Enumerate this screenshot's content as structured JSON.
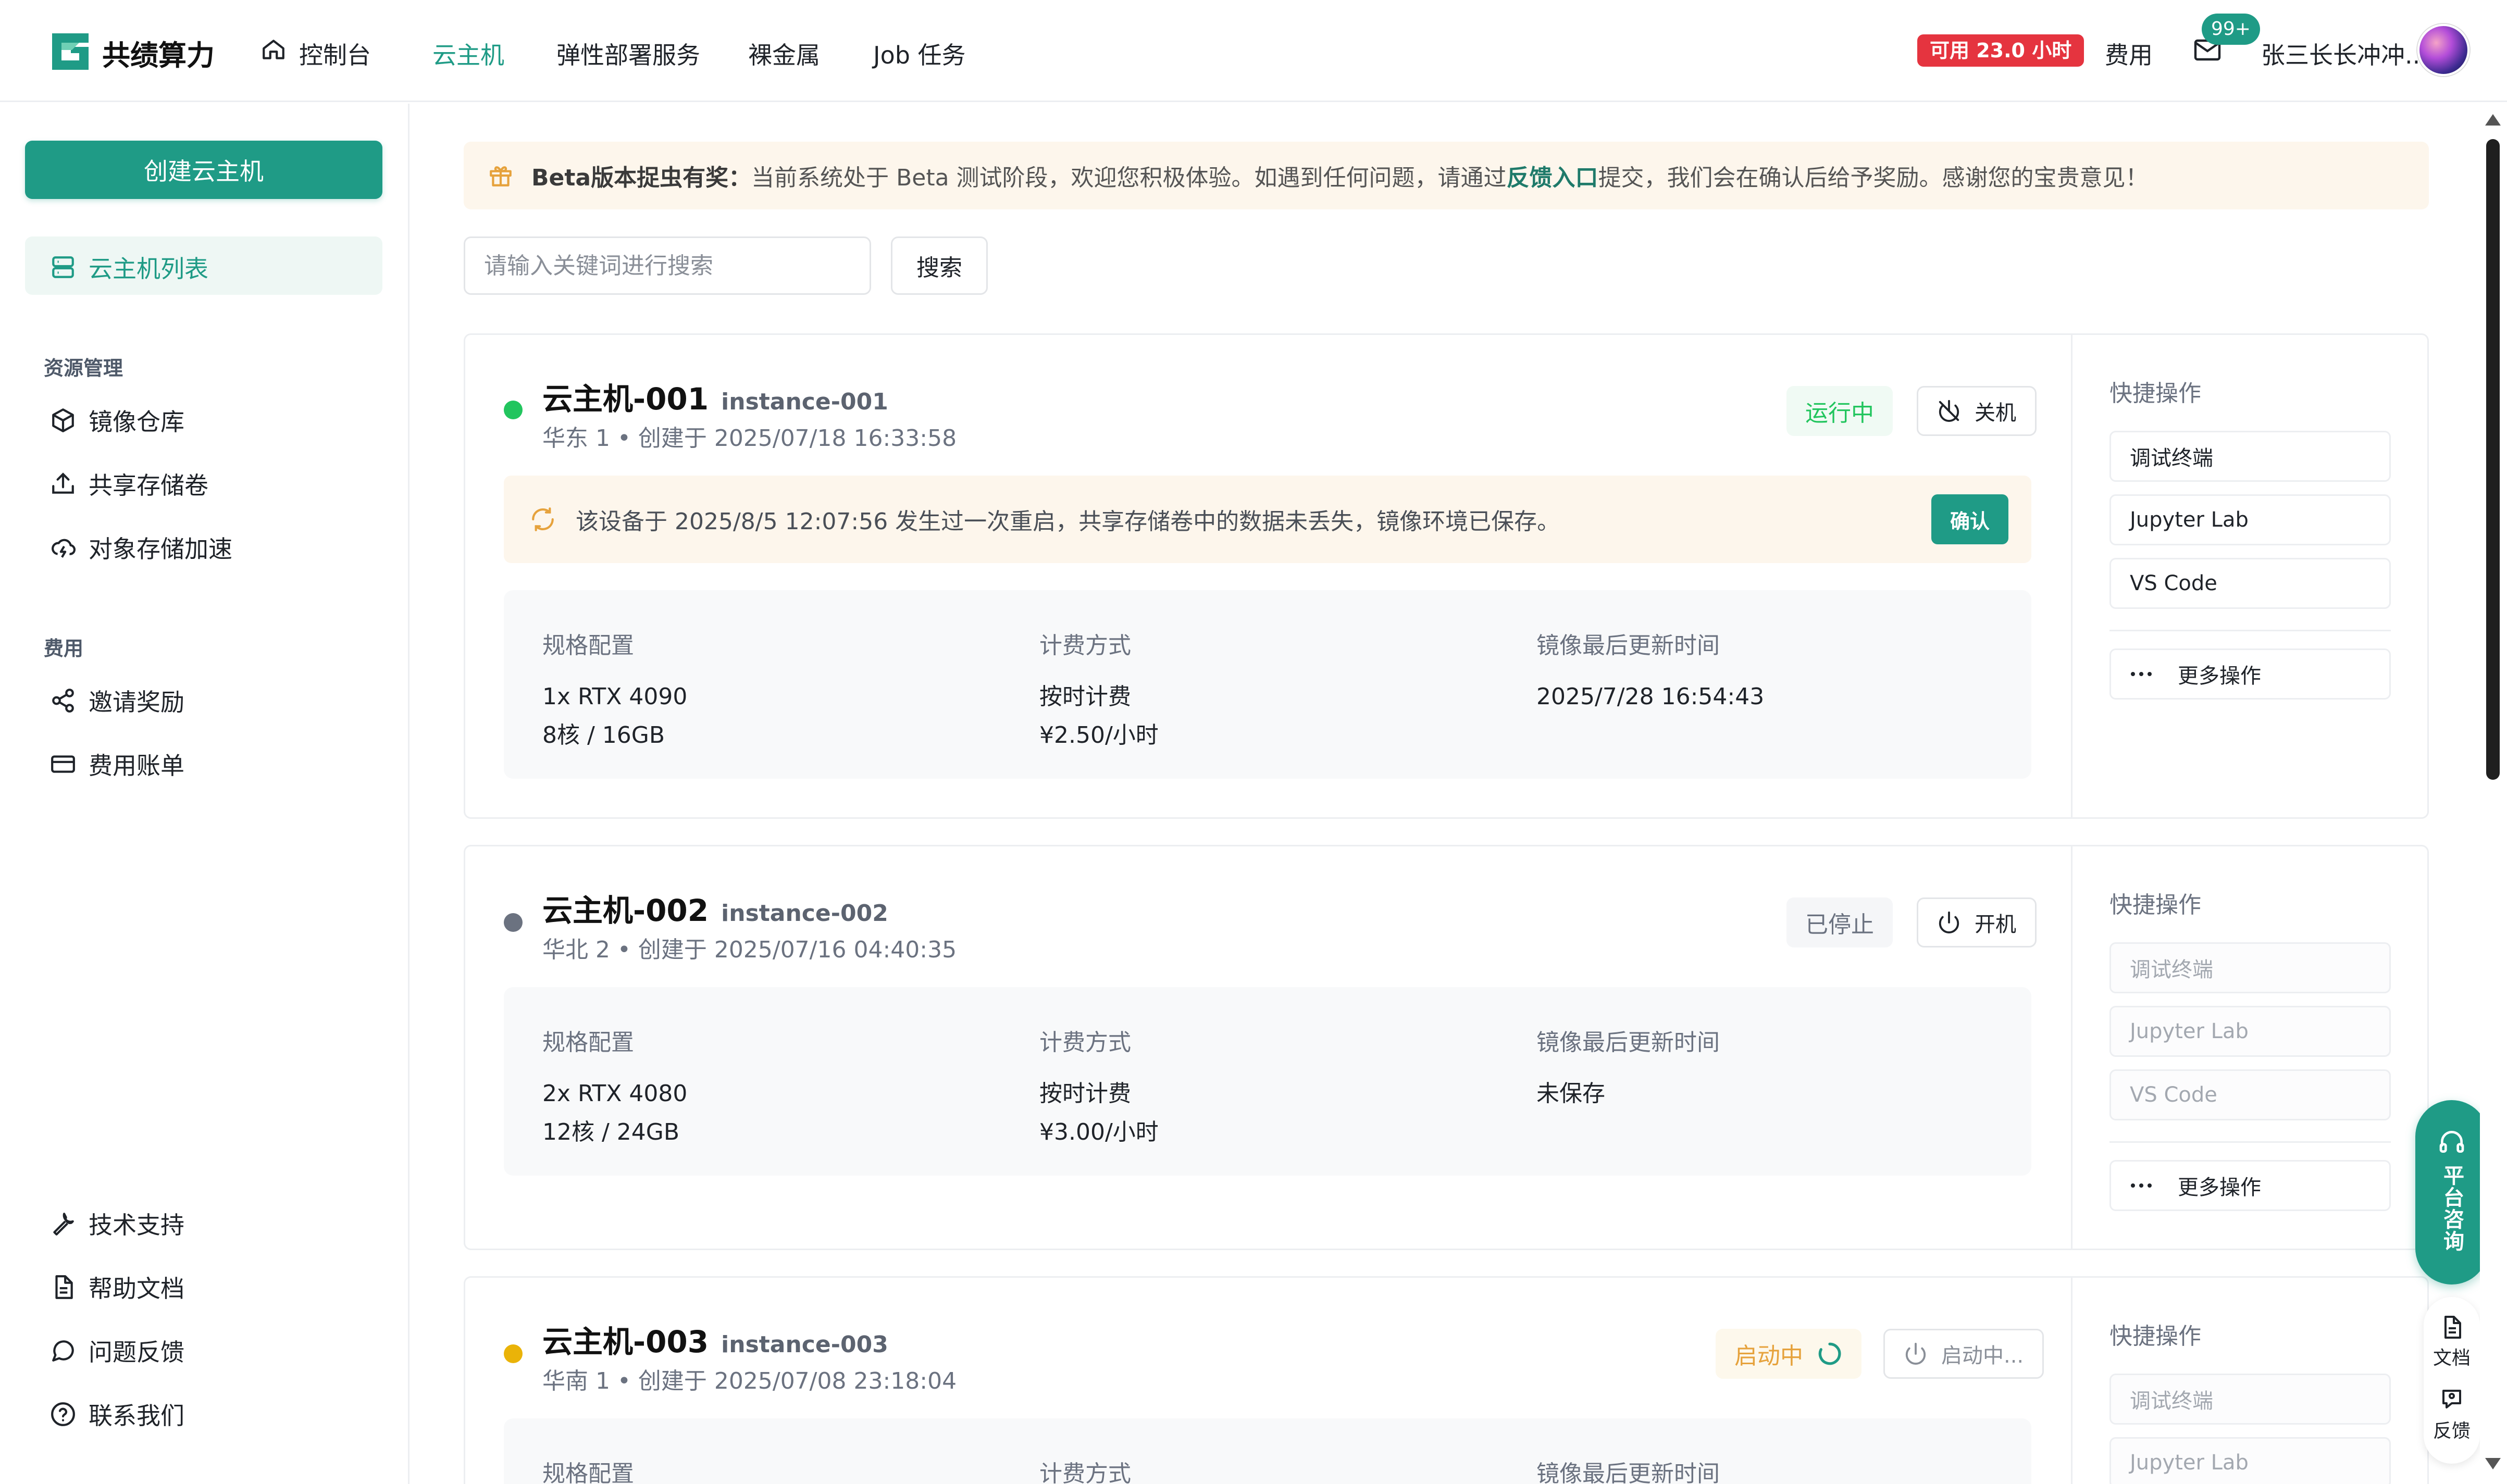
{
  "header": {
    "brand": "共绩算力",
    "nav": [
      {
        "label": "控制台"
      },
      {
        "label": "云主机"
      },
      {
        "label": "弹性部署服务"
      },
      {
        "label": "裸金属"
      },
      {
        "label": "Job 任务"
      }
    ],
    "credit_badge": "可用 23.0 小时",
    "fee_label": "费用",
    "mail_count": "99+",
    "username": "张三长长冲冲..",
    "accent_color": "#1f9b86"
  },
  "sidebar": {
    "create_button": "创建云主机",
    "active_item": "云主机列表",
    "section_resources": "资源管理",
    "resources": [
      "镜像仓库",
      "共享存储卷",
      "对象存储加速"
    ],
    "section_fees": "费用",
    "fees": [
      "邀请奖励",
      "费用账单"
    ],
    "bottom": [
      "技术支持",
      "帮助文档",
      "问题反馈",
      "联系我们"
    ]
  },
  "banner": {
    "title": "Beta版本捉虫有奖：",
    "text_before": "当前系统处于 Beta 测试阶段，欢迎您积极体验。如遇到任何问题，请通过",
    "link": "反馈入口",
    "text_after": "提交，我们会在确认后给予奖励。感谢您的宝贵意见！"
  },
  "search": {
    "placeholder": "请输入关键词进行搜索",
    "button": "搜索"
  },
  "instances": [
    {
      "name": "云主机-001",
      "id": "instance-001",
      "subtitle": "华东 1 • 创建于 2025/07/18 16:33:58",
      "status": "运行中",
      "power_label": "关机",
      "notice": "该设备于 2025/8/5 12:07:56 发生过一次重启，共享存储卷中的数据未丢失，镜像环境已保存。",
      "notice_confirm": "确认",
      "spec_label": "规格配置",
      "spec_gpu": "1x RTX 4090",
      "spec_cpu": "8核 / 16GB",
      "billing_label": "计费方式",
      "billing_mode": "按时计费",
      "billing_price": "¥2.50/小时",
      "image_label": "镜像最后更新时间",
      "image_time": "2025/7/28 16:54:43"
    },
    {
      "name": "云主机-002",
      "id": "instance-002",
      "subtitle": "华北 2 • 创建于 2025/07/16 04:40:35",
      "status": "已停止",
      "power_label": "开机",
      "spec_label": "规格配置",
      "spec_gpu": "2x RTX 4080",
      "spec_cpu": "12核 / 24GB",
      "billing_label": "计费方式",
      "billing_mode": "按时计费",
      "billing_price": "¥3.00/小时",
      "image_label": "镜像最后更新时间",
      "image_time": "未保存"
    },
    {
      "name": "云主机-003",
      "id": "instance-003",
      "subtitle": "华南 1 • 创建于 2025/07/08 23:18:04",
      "status": "启动中",
      "power_label": "启动中...",
      "spec_label": "规格配置",
      "billing_label": "计费方式",
      "image_label": "镜像最后更新时间"
    }
  ],
  "quick_actions": {
    "title": "快捷操作",
    "terminal": "调试终端",
    "jupyter": "Jupyter Lab",
    "vscode": "VS Code",
    "more": "更多操作"
  },
  "float": {
    "consult": "平台咨询",
    "docs": "文档",
    "feedback": "反馈"
  },
  "status_colors": {
    "running": "#22c55e",
    "stopped": "#6b7280",
    "starting": "#eab308"
  }
}
